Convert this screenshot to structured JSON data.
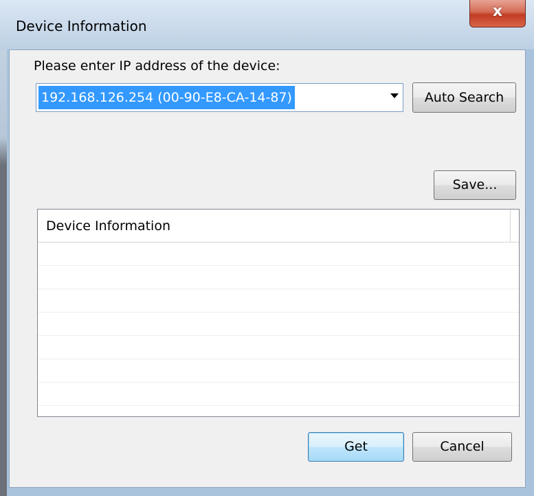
{
  "window": {
    "title": "Device Information",
    "close_symbol": "x"
  },
  "form": {
    "prompt": "Please enter IP address of the device:",
    "ip_selected": "192.168.126.254 (00-90-E8-CA-14-87)"
  },
  "buttons": {
    "auto_search": "Auto Search",
    "save": "Save...",
    "get": "Get",
    "cancel": "Cancel"
  },
  "list": {
    "column_header": "Device Information",
    "rows": []
  },
  "icons": {
    "close": "close-icon",
    "dropdown": "chevron-down-icon"
  }
}
